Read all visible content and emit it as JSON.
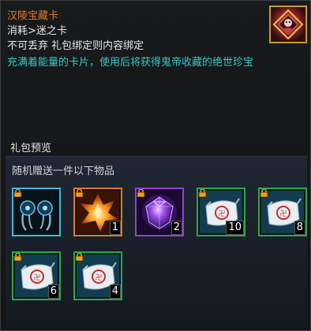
{
  "item": {
    "name": "汉陵宝藏卡",
    "type": "消耗>迷之卡",
    "binding": "不可丢弃 礼包绑定则内容绑定",
    "description": "充满着能量的卡片，使用后将获得鬼帝收藏的绝世珍宝",
    "icon": "treasure-card-icon"
  },
  "preview": {
    "label": "礼包预览",
    "subtitle": "随机赠送一件以下物品",
    "rewards": [
      {
        "icon": "twin-claws-icon",
        "rarity": "cyan",
        "count": ""
      },
      {
        "icon": "fire-crystal-icon",
        "rarity": "orange",
        "count": "1"
      },
      {
        "icon": "purple-gem-icon",
        "rarity": "purple",
        "count": "2"
      },
      {
        "icon": "seal-pouch-icon",
        "rarity": "green",
        "count": "10"
      },
      {
        "icon": "seal-pouch-icon",
        "rarity": "green",
        "count": "8"
      },
      {
        "icon": "seal-pouch-icon",
        "rarity": "green",
        "count": "6"
      },
      {
        "icon": "seal-pouch-icon",
        "rarity": "green",
        "count": "4"
      }
    ]
  },
  "colors": {
    "name": "#e07b2a",
    "description": "#38c8c8",
    "rarity_cyan": "#40b8d8",
    "rarity_orange": "#e07a1a",
    "rarity_purple": "#9b3cd8",
    "rarity_green": "#2aa84a"
  }
}
